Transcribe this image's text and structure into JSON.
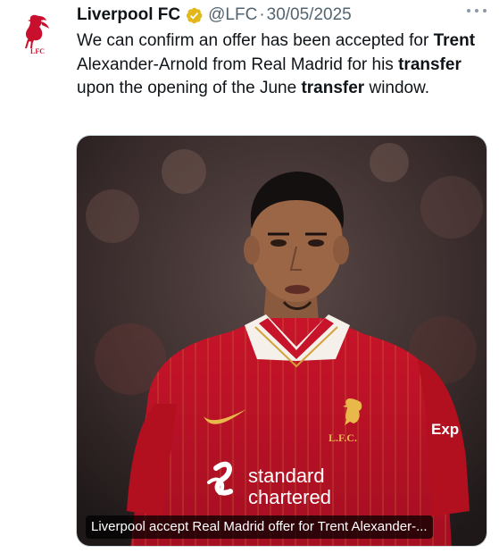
{
  "tweet": {
    "display_name": "Liverpool FC",
    "verified": true,
    "handle": "@LFC",
    "separator": "·",
    "date": "30/05/2025",
    "text_parts": [
      {
        "text": "We can confirm an offer has been accepted for ",
        "bold": false
      },
      {
        "text": "Trent",
        "bold": true
      },
      {
        "text": " Alexander-Arnold from Real Madrid for his ",
        "bold": false
      },
      {
        "text": "transfer",
        "bold": true
      },
      {
        "text": " upon the opening of the June ",
        "bold": false
      },
      {
        "text": "transfer",
        "bold": true
      },
      {
        "text": " window.",
        "bold": false
      }
    ],
    "avatar_text": "LFC",
    "media": {
      "caption": "Liverpool accept Real Madrid offer for Trent Alexander-...",
      "shirt_sponsor": [
        "standard",
        "chartered"
      ],
      "shirt_crest_text": "L.F.C.",
      "sleeve_text": "Exp"
    }
  },
  "colors": {
    "lfc_red": "#c8102e",
    "verified_gold": "#e2b719",
    "muted_text": "#536471"
  },
  "icons": {
    "avatar": "liverbird-crest",
    "badge": "verified-badge-icon",
    "more": "more-options-icon"
  }
}
